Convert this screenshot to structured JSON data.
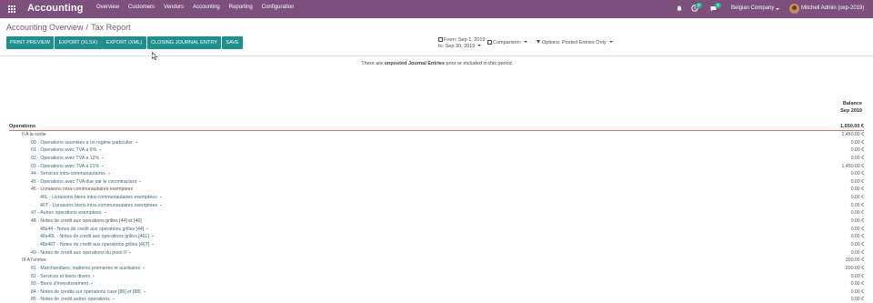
{
  "navbar": {
    "brand": "Accounting",
    "menu": [
      "Overview",
      "Customers",
      "Vendors",
      "Accounting",
      "Reporting",
      "Configuration"
    ],
    "activity_count": "5",
    "message_count": "5",
    "company": "Belgian Company",
    "user": "Mitchell Admin (oxp-2019)"
  },
  "breadcrumb": {
    "parent": "Accounting Overview",
    "separator": "/",
    "current": "Tax Report"
  },
  "buttons": {
    "print_preview": "PRINT PREVIEW",
    "export_xlsx": "EXPORT (XLSX)",
    "export_xml": "EXPORT (XML)",
    "closing_entry": "CLOSING JOURNAL ENTRY",
    "save": "SAVE"
  },
  "filters": {
    "from": "From: Sep 1, 2019",
    "to": "to: Sep 30, 2019",
    "comparison": "Comparison:",
    "options": "Options: Posted Entries Only"
  },
  "report": {
    "warning_prefix": "There are ",
    "warning_bold": "unposted Journal Entries",
    "warning_suffix": " prior or included in this period",
    "column_header": "Balance",
    "column_period": "Sep 2019",
    "section": {
      "label": "Operations",
      "amount": "1,650.00 €"
    },
    "rows": [
      {
        "label": "II A la sortie",
        "amount": "1,450.00 €",
        "level": 1,
        "link": false,
        "dropdown": false
      },
      {
        "label": "00 - Operations soumises a un regime particulier",
        "amount": "0.00 €",
        "level": 2,
        "link": true,
        "dropdown": true
      },
      {
        "label": "01 - Operations avec TVA a 6%",
        "amount": "0.00 €",
        "level": 2,
        "link": true,
        "dropdown": true
      },
      {
        "label": "02 - Operations avec TVA a 12%",
        "amount": "0.00 €",
        "level": 2,
        "link": true,
        "dropdown": true
      },
      {
        "label": "03 - Operations avec TVA a 21%",
        "amount": "1,450.00 €",
        "level": 2,
        "link": true,
        "dropdown": true
      },
      {
        "label": "44 - Services intra-communautaires",
        "amount": "0.00 €",
        "level": 2,
        "link": true,
        "dropdown": true
      },
      {
        "label": "45 - Operations avec TVA due par le cocontractant",
        "amount": "0.00 €",
        "level": 2,
        "link": true,
        "dropdown": true
      },
      {
        "label": "46 - Livraisons intra-communautaires exemptees",
        "amount": "0.00 €",
        "level": 2,
        "link": false,
        "dropdown": false
      },
      {
        "label": "46L - Livraisons biens intra-communautaires exemptees",
        "amount": "0.00 €",
        "level": 3,
        "link": true,
        "dropdown": true
      },
      {
        "label": "46T - Livraisons biens intra-communautaires exemptees",
        "amount": "0.00 €",
        "level": 3,
        "link": true,
        "dropdown": true
      },
      {
        "label": "47 - Autres operations exemptees",
        "amount": "0.00 €",
        "level": 2,
        "link": true,
        "dropdown": true
      },
      {
        "label": "48 - Notes de credit aux operations grilles [44] et [46]",
        "amount": "0.00 €",
        "level": 2,
        "link": false,
        "dropdown": false
      },
      {
        "label": "48s44 - Notes de credit aux operations grilles [44]",
        "amount": "0.00 €",
        "level": 3,
        "link": true,
        "dropdown": true
      },
      {
        "label": "48s46L - Notes de credit aux operations grilles [46L]",
        "amount": "0.00 €",
        "level": 3,
        "link": true,
        "dropdown": true
      },
      {
        "label": "48s46T - Notes de credit aux operations grilles [46T]",
        "amount": "0.00 €",
        "level": 3,
        "link": true,
        "dropdown": true
      },
      {
        "label": "49 - Notes de credit aux operations du point II",
        "amount": "0.00 €",
        "level": 2,
        "link": true,
        "dropdown": true
      },
      {
        "label": "III A l'entree",
        "amount": "200.00 €",
        "level": 1,
        "link": false,
        "dropdown": false
      },
      {
        "label": "81 - Marchandises, matieres premieres et auxiliaires",
        "amount": "200.00 €",
        "level": 2,
        "link": true,
        "dropdown": true
      },
      {
        "label": "82 - Services et biens divers",
        "amount": "0.00 €",
        "level": 2,
        "link": true,
        "dropdown": true
      },
      {
        "label": "83 - Biens d'investissement",
        "amount": "0.00 €",
        "level": 2,
        "link": true,
        "dropdown": true
      },
      {
        "label": "84 - Notes de credits sur operations case [86] et [88]",
        "amount": "0.00 €",
        "level": 2,
        "link": true,
        "dropdown": true
      },
      {
        "label": "85 - Notes de credit autres operations",
        "amount": "0.00 €",
        "level": 2,
        "link": true,
        "dropdown": true
      }
    ]
  },
  "colors": {
    "navbar": "#7c4f7c",
    "button": "#1f8f8c",
    "section_rule": "#c97a5e",
    "link": "#3a6a7a"
  }
}
